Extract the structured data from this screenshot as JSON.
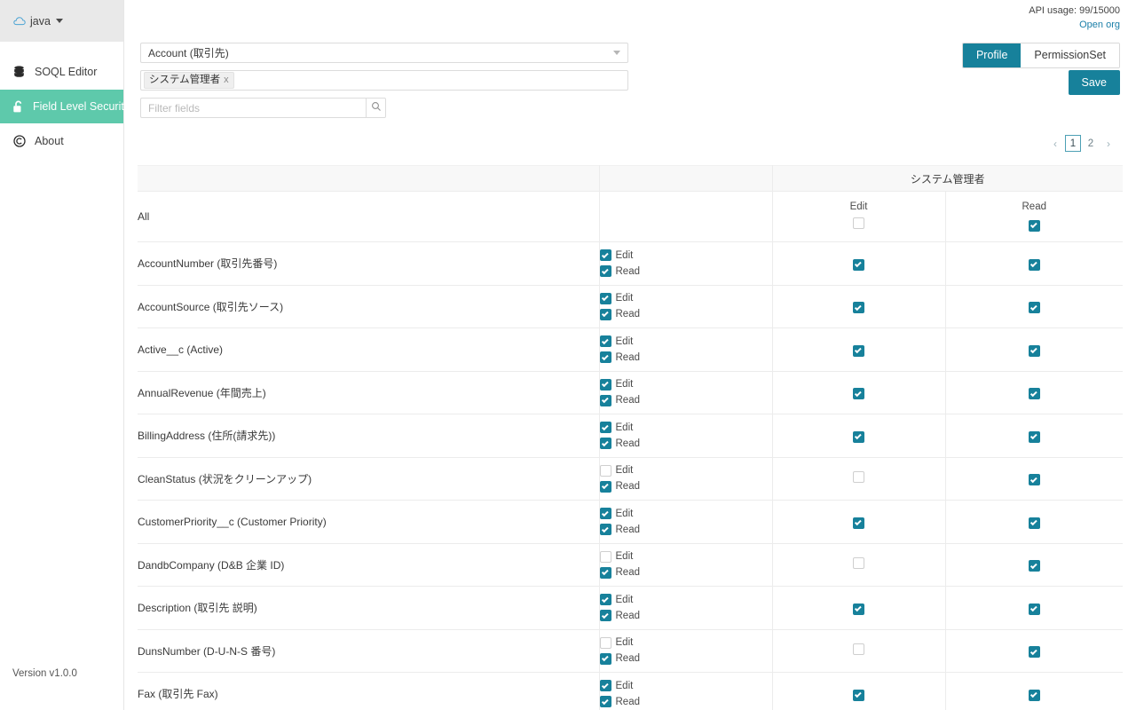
{
  "sidebar": {
    "org": {
      "name": "java",
      "icon": "cloud-icon",
      "caret": "chevron-down-icon"
    },
    "items": [
      {
        "id": "soql-editor",
        "label": "SOQL Editor",
        "icon": "database-icon",
        "active": false
      },
      {
        "id": "field-level-security",
        "label": "Field Level Security",
        "icon": "unlock-icon",
        "active": true
      },
      {
        "id": "about",
        "label": "About",
        "icon": "copyright-icon",
        "active": false
      }
    ],
    "version": "Version v1.0.0"
  },
  "header": {
    "api_usage": "API usage: 99/15000",
    "open_org_link": "Open org",
    "mode_tabs": [
      {
        "label": "Profile",
        "selected": true
      },
      {
        "label": "PermissionSet",
        "selected": false
      }
    ],
    "save_label": "Save"
  },
  "controls": {
    "object_select": {
      "value": "Account (取引先)",
      "icon": "chevron-down-icon"
    },
    "profile_chips": [
      {
        "label": "システム管理者",
        "remove": "x"
      }
    ],
    "filter": {
      "placeholder": "Filter fields",
      "value": "",
      "icon": "search-icon"
    }
  },
  "pagination": {
    "prev": "‹",
    "next": "›",
    "pages": [
      "1",
      "2"
    ],
    "current": "1"
  },
  "table": {
    "group_header": "システム管理者",
    "sub_headers": {
      "edit": "Edit",
      "read": "Read"
    },
    "pair_labels": {
      "edit": "Edit",
      "read": "Read"
    },
    "all_row": {
      "label": "All",
      "edit_checked": false,
      "read_checked": true
    },
    "rows": [
      {
        "field": "AccountNumber (取引先番号)",
        "pair_edit": true,
        "pair_read": true,
        "edit_checked": true,
        "read_checked": true
      },
      {
        "field": "AccountSource (取引先ソース)",
        "pair_edit": true,
        "pair_read": true,
        "edit_checked": true,
        "read_checked": true
      },
      {
        "field": "Active__c (Active)",
        "pair_edit": true,
        "pair_read": true,
        "edit_checked": true,
        "read_checked": true
      },
      {
        "field": "AnnualRevenue (年間売上)",
        "pair_edit": true,
        "pair_read": true,
        "edit_checked": true,
        "read_checked": true
      },
      {
        "field": "BillingAddress (住所(請求先))",
        "pair_edit": true,
        "pair_read": true,
        "edit_checked": true,
        "read_checked": true
      },
      {
        "field": "CleanStatus (状況をクリーンアップ)",
        "pair_edit": false,
        "pair_read": true,
        "edit_checked": false,
        "read_checked": true
      },
      {
        "field": "CustomerPriority__c (Customer Priority)",
        "pair_edit": true,
        "pair_read": true,
        "edit_checked": true,
        "read_checked": true
      },
      {
        "field": "DandbCompany (D&B 企業 ID)",
        "pair_edit": false,
        "pair_read": true,
        "edit_checked": false,
        "read_checked": true
      },
      {
        "field": "Description (取引先 説明)",
        "pair_edit": true,
        "pair_read": true,
        "edit_checked": true,
        "read_checked": true
      },
      {
        "field": "DunsNumber (D-U-N-S 番号)",
        "pair_edit": false,
        "pair_read": true,
        "edit_checked": false,
        "read_checked": true
      },
      {
        "field": "Fax (取引先 Fax)",
        "pair_edit": true,
        "pair_read": true,
        "edit_checked": true,
        "read_checked": true
      }
    ]
  },
  "colors": {
    "accent_teal": "#17819b",
    "active_nav": "#5ec9ab",
    "link": "#1a7fa8",
    "border": "#ececec"
  }
}
